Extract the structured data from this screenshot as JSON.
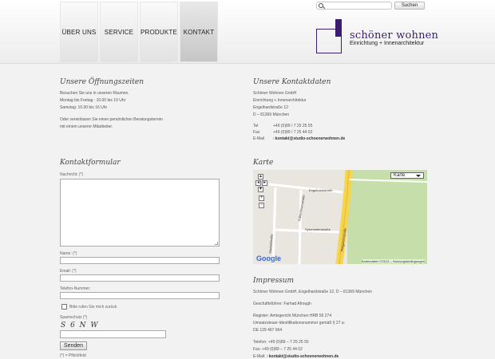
{
  "nav": [
    "ÜBER UNS",
    "SERVICE",
    "PRODUKTE",
    "KONTAKT"
  ],
  "search": {
    "placeholder": "",
    "button": "Suchen"
  },
  "logo": {
    "name": "schöner wohnen",
    "sub": "Einrichtung + Innenarchitektur"
  },
  "hours": {
    "title": "Unsere Öffnungszeiten",
    "lines": [
      "Besuchen Sie uns in unseren Räumen.",
      "Montag bis Freitag : 10.00 bis 19 Uhr",
      "Samstag: 10.00 bis 16 Uhr"
    ],
    "note": [
      "Oder vereinbaren Sie einen persönlichen Beratungstermin",
      "mit einem unserer Mitarbeiter."
    ]
  },
  "contact": {
    "title": "Unsere Kontaktdaten",
    "lines": [
      "Schöner Wohnen GmbH",
      "Einrichtung + Innenarchitektur",
      "Engelhardstraße 12",
      "D – 81369 München"
    ],
    "tel_label": "Tel",
    "tel": "+49 (0)89 / 7 25 25 55",
    "fax_label": "Fax",
    "fax": "+49 (0)89 / 7 25 44 02",
    "email_label": "E-Mail",
    "email": "kontakt@studio-schoenerwohnen.de"
  },
  "form": {
    "title": "Kontaktformular",
    "message_label": "Nachricht: (*)",
    "name_label": "Name: (*)",
    "email_label": "Email: (*)",
    "phone_label": "Telefon-Nummer:",
    "callback_label": "Bitte rufen Sie mich zurück",
    "spam_label": "Spamschutz (*)",
    "captcha": "S 6 N W",
    "submit": "Senden",
    "required_note": "(*) = Pflichtfeld"
  },
  "map": {
    "title": "Karte",
    "type": "Karte",
    "google": "Google",
    "attribution": "Kartendaten ©2013 – Nutzungsbedingungen",
    "streets": [
      "Engelhardstraße",
      "Kaltenbrunnstraße",
      "Sylvensteinstraße",
      "Plinganserstraße",
      "Maxhofstraße"
    ]
  },
  "impressum": {
    "title": "Impressum",
    "address": "Schöner Wohnen GmbH, Engelhardstraße 12, D – 81369 München",
    "manager": "Geschäftsführer: Farhad Afrough",
    "register": "Register: Amtsgericht München HRB 56 274",
    "vat_line": "Umsatzsteuer-Identifikationsnummer gemäß § 27 a:",
    "vat_id": "DE 129 467 964",
    "tel": "Telefon: +49 (0)89 – 7 25 25 55",
    "fax": "Fax: +49 (0)89 – 7 25 44 02",
    "email_label": "E-Mail:",
    "email": "kontakt@studio-schoenerwohnen.de"
  }
}
